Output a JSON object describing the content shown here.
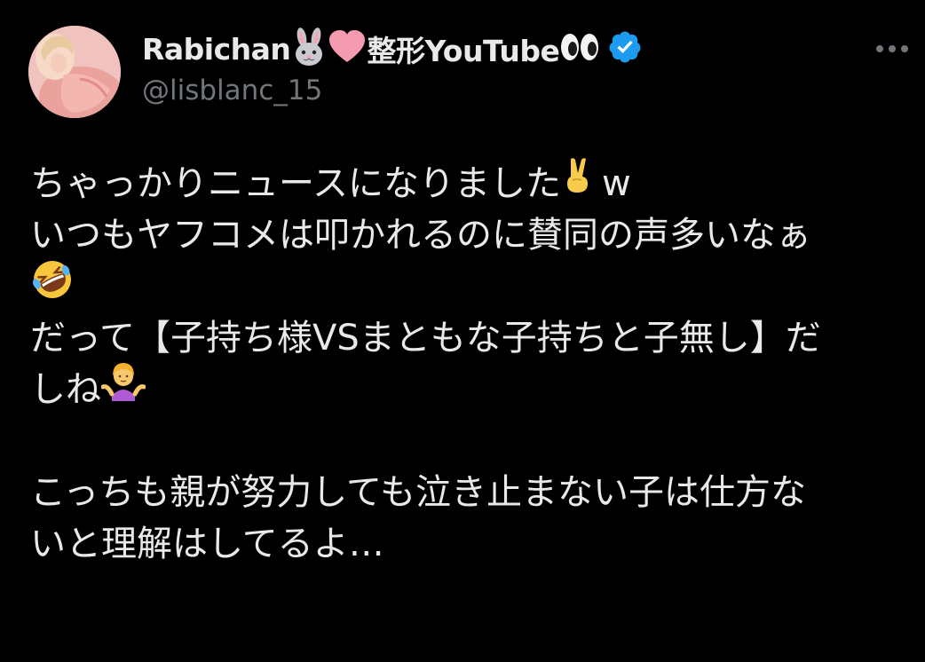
{
  "post": {
    "display_name": "Rabichan",
    "display_name_suffix": "整形YouTube",
    "handle": "@lisblanc_15",
    "verified": true,
    "body_lines": [
      "ちゃっかりニュースになりました",
      "w",
      "いつもヤフコメは叩かれるのに賛同の声多いなぁ",
      "",
      "だって【子持ち様VSまともな子持ちと子無し】だ",
      "しね",
      "",
      "こっちも親が努力しても泣き止まない子は仕方な",
      "いと理解はしてるよ…"
    ]
  },
  "icons": {
    "name_emojis": [
      "rabbit-face-icon",
      "pink-heart-icon",
      "eyes-icon"
    ],
    "verified": "verified-badge-icon",
    "more": "more-options-icon",
    "body_emojis": [
      "victory-hand-icon",
      "rolling-laughing-icon",
      "person-shrugging-icon"
    ]
  },
  "colors": {
    "background": "#000000",
    "text": "#e7e9ea",
    "secondary_text": "#71767b",
    "verified_blue": "#1d9bf0"
  }
}
